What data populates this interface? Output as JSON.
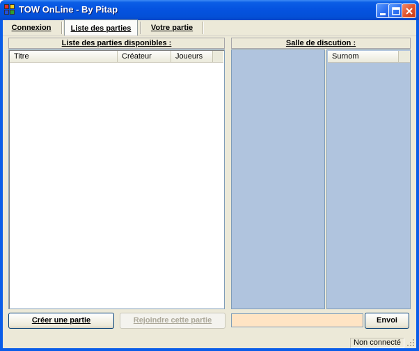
{
  "window": {
    "title": "TOW OnLine - By Pitap"
  },
  "tabs": [
    {
      "label": "Connexion",
      "active": false
    },
    {
      "label": "Liste des parties",
      "active": true
    },
    {
      "label": "Votre partie",
      "active": false
    }
  ],
  "games_panel": {
    "header": "Liste des parties disponibles :",
    "columns": [
      "Titre",
      "Créateur",
      "Joueurs"
    ],
    "rows": [],
    "create_button": "Créer une partie",
    "join_button": "Rejoindre cette partie"
  },
  "chat_panel": {
    "header": "Salle de discution :",
    "users_column": "Surnom",
    "message_value": "",
    "send_button": "Envoi"
  },
  "statusbar": {
    "connection": "Non connecté"
  },
  "colors": {
    "chat_background": "#b0c4de",
    "message_input_background": "#ffe4c4",
    "window_face": "#ece9d8"
  }
}
